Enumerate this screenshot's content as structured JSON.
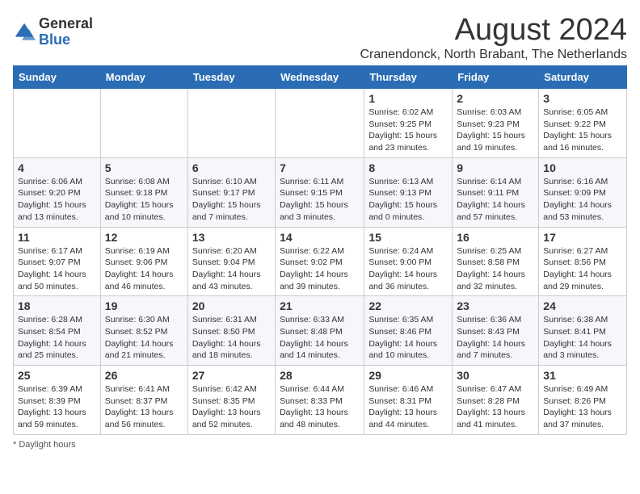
{
  "logo": {
    "general": "General",
    "blue": "Blue"
  },
  "title": "August 2024",
  "subtitle": "Cranendonck, North Brabant, The Netherlands",
  "days_of_week": [
    "Sunday",
    "Monday",
    "Tuesday",
    "Wednesday",
    "Thursday",
    "Friday",
    "Saturday"
  ],
  "footer": "Daylight hours",
  "weeks": [
    [
      {
        "day": "",
        "info": ""
      },
      {
        "day": "",
        "info": ""
      },
      {
        "day": "",
        "info": ""
      },
      {
        "day": "",
        "info": ""
      },
      {
        "day": "1",
        "info": "Sunrise: 6:02 AM\nSunset: 9:25 PM\nDaylight: 15 hours\nand 23 minutes."
      },
      {
        "day": "2",
        "info": "Sunrise: 6:03 AM\nSunset: 9:23 PM\nDaylight: 15 hours\nand 19 minutes."
      },
      {
        "day": "3",
        "info": "Sunrise: 6:05 AM\nSunset: 9:22 PM\nDaylight: 15 hours\nand 16 minutes."
      }
    ],
    [
      {
        "day": "4",
        "info": "Sunrise: 6:06 AM\nSunset: 9:20 PM\nDaylight: 15 hours\nand 13 minutes."
      },
      {
        "day": "5",
        "info": "Sunrise: 6:08 AM\nSunset: 9:18 PM\nDaylight: 15 hours\nand 10 minutes."
      },
      {
        "day": "6",
        "info": "Sunrise: 6:10 AM\nSunset: 9:17 PM\nDaylight: 15 hours\nand 7 minutes."
      },
      {
        "day": "7",
        "info": "Sunrise: 6:11 AM\nSunset: 9:15 PM\nDaylight: 15 hours\nand 3 minutes."
      },
      {
        "day": "8",
        "info": "Sunrise: 6:13 AM\nSunset: 9:13 PM\nDaylight: 15 hours\nand 0 minutes."
      },
      {
        "day": "9",
        "info": "Sunrise: 6:14 AM\nSunset: 9:11 PM\nDaylight: 14 hours\nand 57 minutes."
      },
      {
        "day": "10",
        "info": "Sunrise: 6:16 AM\nSunset: 9:09 PM\nDaylight: 14 hours\nand 53 minutes."
      }
    ],
    [
      {
        "day": "11",
        "info": "Sunrise: 6:17 AM\nSunset: 9:07 PM\nDaylight: 14 hours\nand 50 minutes."
      },
      {
        "day": "12",
        "info": "Sunrise: 6:19 AM\nSunset: 9:06 PM\nDaylight: 14 hours\nand 46 minutes."
      },
      {
        "day": "13",
        "info": "Sunrise: 6:20 AM\nSunset: 9:04 PM\nDaylight: 14 hours\nand 43 minutes."
      },
      {
        "day": "14",
        "info": "Sunrise: 6:22 AM\nSunset: 9:02 PM\nDaylight: 14 hours\nand 39 minutes."
      },
      {
        "day": "15",
        "info": "Sunrise: 6:24 AM\nSunset: 9:00 PM\nDaylight: 14 hours\nand 36 minutes."
      },
      {
        "day": "16",
        "info": "Sunrise: 6:25 AM\nSunset: 8:58 PM\nDaylight: 14 hours\nand 32 minutes."
      },
      {
        "day": "17",
        "info": "Sunrise: 6:27 AM\nSunset: 8:56 PM\nDaylight: 14 hours\nand 29 minutes."
      }
    ],
    [
      {
        "day": "18",
        "info": "Sunrise: 6:28 AM\nSunset: 8:54 PM\nDaylight: 14 hours\nand 25 minutes."
      },
      {
        "day": "19",
        "info": "Sunrise: 6:30 AM\nSunset: 8:52 PM\nDaylight: 14 hours\nand 21 minutes."
      },
      {
        "day": "20",
        "info": "Sunrise: 6:31 AM\nSunset: 8:50 PM\nDaylight: 14 hours\nand 18 minutes."
      },
      {
        "day": "21",
        "info": "Sunrise: 6:33 AM\nSunset: 8:48 PM\nDaylight: 14 hours\nand 14 minutes."
      },
      {
        "day": "22",
        "info": "Sunrise: 6:35 AM\nSunset: 8:46 PM\nDaylight: 14 hours\nand 10 minutes."
      },
      {
        "day": "23",
        "info": "Sunrise: 6:36 AM\nSunset: 8:43 PM\nDaylight: 14 hours\nand 7 minutes."
      },
      {
        "day": "24",
        "info": "Sunrise: 6:38 AM\nSunset: 8:41 PM\nDaylight: 14 hours\nand 3 minutes."
      }
    ],
    [
      {
        "day": "25",
        "info": "Sunrise: 6:39 AM\nSunset: 8:39 PM\nDaylight: 13 hours\nand 59 minutes."
      },
      {
        "day": "26",
        "info": "Sunrise: 6:41 AM\nSunset: 8:37 PM\nDaylight: 13 hours\nand 56 minutes."
      },
      {
        "day": "27",
        "info": "Sunrise: 6:42 AM\nSunset: 8:35 PM\nDaylight: 13 hours\nand 52 minutes."
      },
      {
        "day": "28",
        "info": "Sunrise: 6:44 AM\nSunset: 8:33 PM\nDaylight: 13 hours\nand 48 minutes."
      },
      {
        "day": "29",
        "info": "Sunrise: 6:46 AM\nSunset: 8:31 PM\nDaylight: 13 hours\nand 44 minutes."
      },
      {
        "day": "30",
        "info": "Sunrise: 6:47 AM\nSunset: 8:28 PM\nDaylight: 13 hours\nand 41 minutes."
      },
      {
        "day": "31",
        "info": "Sunrise: 6:49 AM\nSunset: 8:26 PM\nDaylight: 13 hours\nand 37 minutes."
      }
    ]
  ]
}
